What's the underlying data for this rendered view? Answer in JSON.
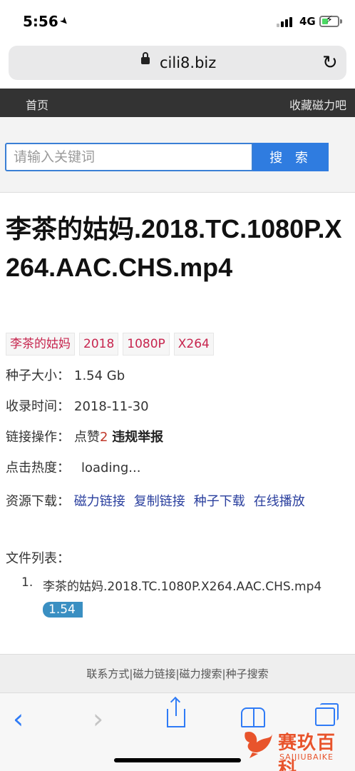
{
  "status_bar": {
    "time": "5:56",
    "network": "4G"
  },
  "browser": {
    "url": "cili8.biz"
  },
  "site_nav": {
    "home": "首页",
    "bookmark": "收藏磁力吧"
  },
  "search": {
    "placeholder": "请输入关键词",
    "button": "搜 索"
  },
  "torrent": {
    "title": "李茶的姑妈.2018.TC.1080P.X264.AAC.CHS.mp4",
    "tags": [
      "李茶的姑妈",
      "2018",
      "1080P",
      "X264"
    ],
    "size_label": "种子大小：",
    "size_value": "1.54 Gb",
    "date_label": "收录时间：",
    "date_value": "2018-11-30",
    "ops_label": "链接操作：",
    "like_text": "点赞",
    "like_count": "2",
    "report_text": "违规举报",
    "heat_label": "点击热度：",
    "heat_value": "loading...",
    "download_label": "资源下载：",
    "download_links": [
      "磁力链接",
      "复制链接",
      "种子下载",
      "在线播放"
    ],
    "files_label": "文件列表：",
    "files": [
      {
        "index": "1.",
        "name": "李茶的姑妈.2018.TC.1080P.X264.AAC.CHS.mp4",
        "size": "1.54"
      }
    ]
  },
  "footer": {
    "text": "联系方式|磁力链接|磁力搜索|种子搜索"
  },
  "toolbar_icons": [
    "back-arrow",
    "forward-arrow",
    "share",
    "bookmarks",
    "tabs"
  ],
  "watermark": {
    "title": "赛玖百科",
    "subtitle": "SAIJIUBAIKE"
  },
  "colors": {
    "nav_bg": "#333333",
    "search_button": "#2f7ce0",
    "tag_text": "#c7254e",
    "link": "#2a3f9e",
    "badge": "#3a8fc2",
    "ios_blue": "#2f7bf6"
  }
}
